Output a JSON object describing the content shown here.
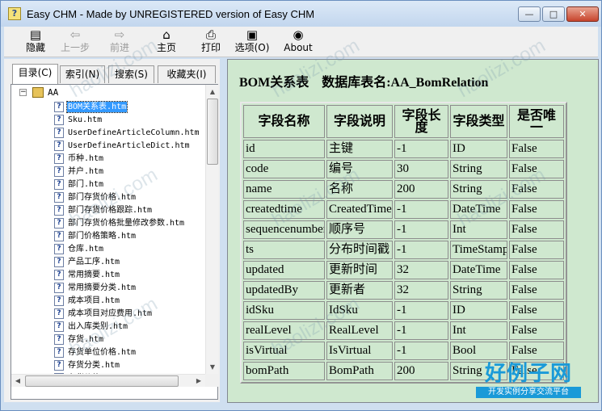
{
  "window": {
    "title": "Easy CHM - Made by UNREGISTERED version of Easy CHM",
    "controls": {
      "minimize": "—",
      "maximize": "□",
      "close": "✕"
    }
  },
  "toolbar": {
    "items": [
      {
        "label": "隐藏",
        "icon": "hide-icon",
        "glyph": "▤",
        "enabled": true
      },
      {
        "label": "上一步",
        "icon": "back-arrow-icon",
        "glyph": "⇦",
        "enabled": false
      },
      {
        "label": "前进",
        "icon": "forward-arrow-icon",
        "glyph": "⇨",
        "enabled": false
      },
      {
        "label": "主页",
        "icon": "home-icon",
        "glyph": "⌂",
        "enabled": true
      },
      {
        "label": "打印",
        "icon": "printer-icon",
        "glyph": "⎙",
        "enabled": true
      },
      {
        "label": "选项(O)",
        "icon": "options-icon",
        "glyph": "▣",
        "enabled": true
      },
      {
        "label": "About",
        "icon": "about-icon",
        "glyph": "◉",
        "enabled": true
      }
    ]
  },
  "nav": {
    "tabs": [
      {
        "label": "目录(C)",
        "active": true
      },
      {
        "label": "索引(N)",
        "active": false
      },
      {
        "label": "搜索(S)",
        "active": false
      },
      {
        "label": "收藏夹(I)",
        "active": false
      }
    ],
    "tree": {
      "root": {
        "label": "AA",
        "expander": "−"
      },
      "items": [
        {
          "label": "BOM关系表.htm",
          "selected": true
        },
        {
          "label": "Sku.htm"
        },
        {
          "label": "UserDefineArticleColumn.htm"
        },
        {
          "label": "UserDefineArticleDict.htm"
        },
        {
          "label": "币种.htm"
        },
        {
          "label": "并户.htm"
        },
        {
          "label": "部门.htm"
        },
        {
          "label": "部门存货价格.htm"
        },
        {
          "label": "部门存货价格跟踪.htm"
        },
        {
          "label": "部门存货价格批量修改参数.htm"
        },
        {
          "label": "部门价格策略.htm"
        },
        {
          "label": "仓库.htm"
        },
        {
          "label": "产品工序.htm"
        },
        {
          "label": "常用摘要.htm"
        },
        {
          "label": "常用摘要分类.htm"
        },
        {
          "label": "成本项目.htm"
        },
        {
          "label": "成本项目对应费用.htm"
        },
        {
          "label": "出入库类别.htm"
        },
        {
          "label": "存货.htm"
        },
        {
          "label": "存货单位价格.htm"
        },
        {
          "label": "存货分类.htm"
        },
        {
          "label": "存货价格.htm"
        }
      ]
    }
  },
  "content": {
    "heading": "BOM关系表　数据库表名:AA_BomRelation",
    "columns": [
      "字段名称",
      "字段说明",
      "字段长度",
      "字段类型",
      "是否唯一"
    ],
    "rows": [
      [
        "id",
        "主键",
        "-1",
        "ID",
        "False"
      ],
      [
        "code",
        "编号",
        "30",
        "String",
        "False"
      ],
      [
        "name",
        "名称",
        "200",
        "String",
        "False"
      ],
      [
        "createdtime",
        "CreatedTime",
        "-1",
        "DateTime",
        "False"
      ],
      [
        "sequencenumber",
        "顺序号",
        "-1",
        "Int",
        "False"
      ],
      [
        "ts",
        "分布时间戳",
        "-1",
        "TimeStamp",
        "False"
      ],
      [
        "updated",
        "更新时间",
        "32",
        "DateTime",
        "False"
      ],
      [
        "updatedBy",
        "更新者",
        "32",
        "String",
        "False"
      ],
      [
        "idSku",
        "IdSku",
        "-1",
        "ID",
        "False"
      ],
      [
        "realLevel",
        "RealLevel",
        "-1",
        "Int",
        "False"
      ],
      [
        "isVirtual",
        "IsVirtual",
        "-1",
        "Bool",
        "False"
      ],
      [
        "bomPath",
        "BomPath",
        "200",
        "String",
        "False"
      ]
    ]
  },
  "watermark": {
    "text": "haolizi.com",
    "logo_title": "好例子网",
    "logo_subtitle": "开发实例分享交流平台"
  }
}
